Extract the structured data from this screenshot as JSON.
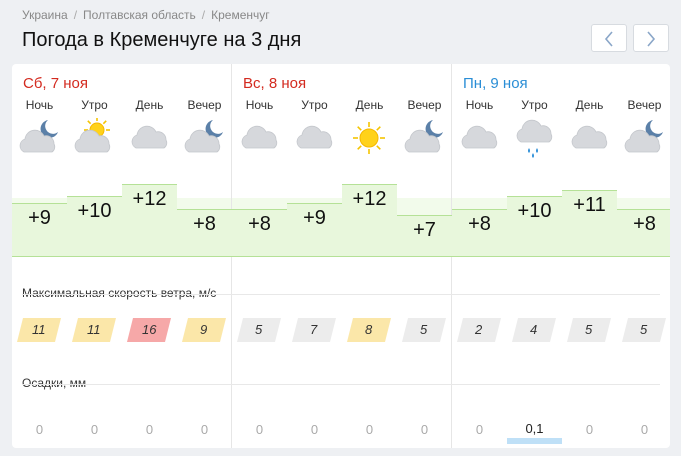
{
  "breadcrumb": [
    "Украина",
    "Полтавская область",
    "Кременчуг"
  ],
  "page_title": "Погода в Кременчуге на 3 дня",
  "nav": {
    "prev_icon": "chevron-left-icon",
    "next_icon": "chevron-right-icon"
  },
  "days": [
    {
      "label": "Сб, 7 ноя",
      "weekend": true
    },
    {
      "label": "Вс, 8 ноя",
      "weekend": true
    },
    {
      "label": "Пн, 9 ноя",
      "weekend": false
    }
  ],
  "periods": [
    {
      "label": "Ночь",
      "icon": "cloud-moon-icon",
      "temp": "+9",
      "wind": "11",
      "precip": "0"
    },
    {
      "label": "Утро",
      "icon": "cloud-sun-icon",
      "temp": "+10",
      "wind": "11",
      "precip": "0"
    },
    {
      "label": "День",
      "icon": "cloud-icon",
      "temp": "+12",
      "wind": "16",
      "precip": "0"
    },
    {
      "label": "Вечер",
      "icon": "cloud-moon-icon",
      "temp": "+8",
      "wind": "9",
      "precip": "0"
    },
    {
      "label": "Ночь",
      "icon": "cloud-icon",
      "temp": "+8",
      "wind": "5",
      "precip": "0"
    },
    {
      "label": "Утро",
      "icon": "cloud-icon",
      "temp": "+9",
      "wind": "7",
      "precip": "0"
    },
    {
      "label": "День",
      "icon": "sun-icon",
      "temp": "+12",
      "wind": "8",
      "precip": "0"
    },
    {
      "label": "Вечер",
      "icon": "cloud-moon-icon",
      "temp": "+7",
      "wind": "5",
      "precip": "0"
    },
    {
      "label": "Ночь",
      "icon": "cloud-icon",
      "temp": "+8",
      "wind": "2",
      "precip": "0"
    },
    {
      "label": "Утро",
      "icon": "rain-cloud-icon",
      "temp": "+10",
      "wind": "4",
      "precip": "0,1"
    },
    {
      "label": "День",
      "icon": "cloud-icon",
      "temp": "+11",
      "wind": "5",
      "precip": "0"
    },
    {
      "label": "Вечер",
      "icon": "cloud-moon-icon",
      "temp": "+8",
      "wind": "5",
      "precip": "0"
    }
  ],
  "wind_section": {
    "label": "Максимальная скорость ветра, м/с"
  },
  "precip_section": {
    "label": "Осадки, мм"
  },
  "colors": {
    "weekend": "#d32a1f",
    "weekday": "#2a8ed6",
    "temp_fill": "#e8f7dc",
    "temp_border": "#b5e197",
    "wind_calm": "#ececec",
    "wind_moderate": "#fbe7a9",
    "wind_strong": "#f6a8a8",
    "precip_bar": "#bfe0f7"
  }
}
